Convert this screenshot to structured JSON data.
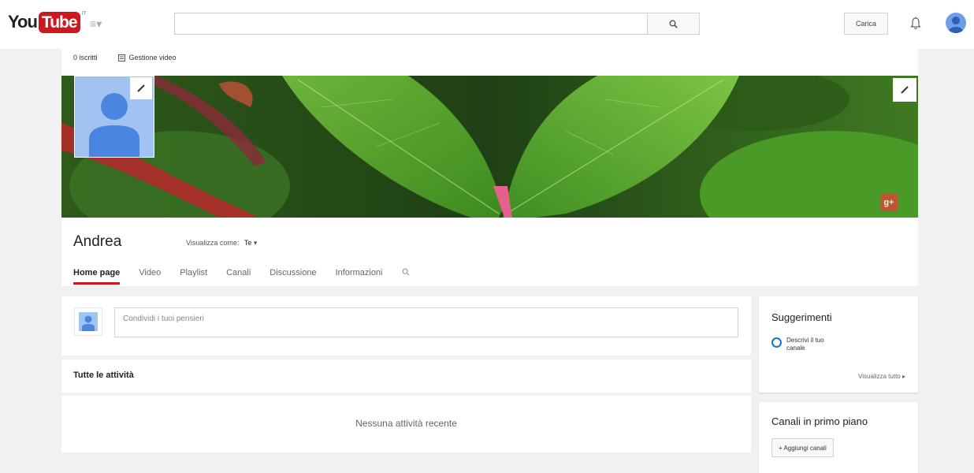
{
  "masthead": {
    "logo_you": "You",
    "logo_tube": "Tube",
    "logo_country": "IT",
    "upload_label": "Carica"
  },
  "channel": {
    "subscribers": "0 iscritti",
    "manage_videos": "Gestione video",
    "name": "Andrea",
    "view_as_label": "Visualizza come:",
    "view_as_value": "Te",
    "tabs": [
      {
        "label": "Home page",
        "active": true
      },
      {
        "label": "Video"
      },
      {
        "label": "Playlist"
      },
      {
        "label": "Canali"
      },
      {
        "label": "Discussione"
      },
      {
        "label": "Informazioni"
      }
    ]
  },
  "feed": {
    "share_placeholder": "Condividi i tuoi pensieri",
    "activity_title": "Tutte le attività",
    "empty_message": "Nessuna attività recente"
  },
  "sidebar": {
    "suggestions_title": "Suggerimenti",
    "suggestion_item": "Descrivi il tuo canale",
    "view_all": "Visualizza tutto",
    "featured_title": "Canali in primo piano",
    "add_channels": "+ Aggiungi canali"
  },
  "colors": {
    "brand_red": "#cc181e",
    "avatar_blue": "#6f9ee8",
    "link_blue": "#1a73c8"
  }
}
